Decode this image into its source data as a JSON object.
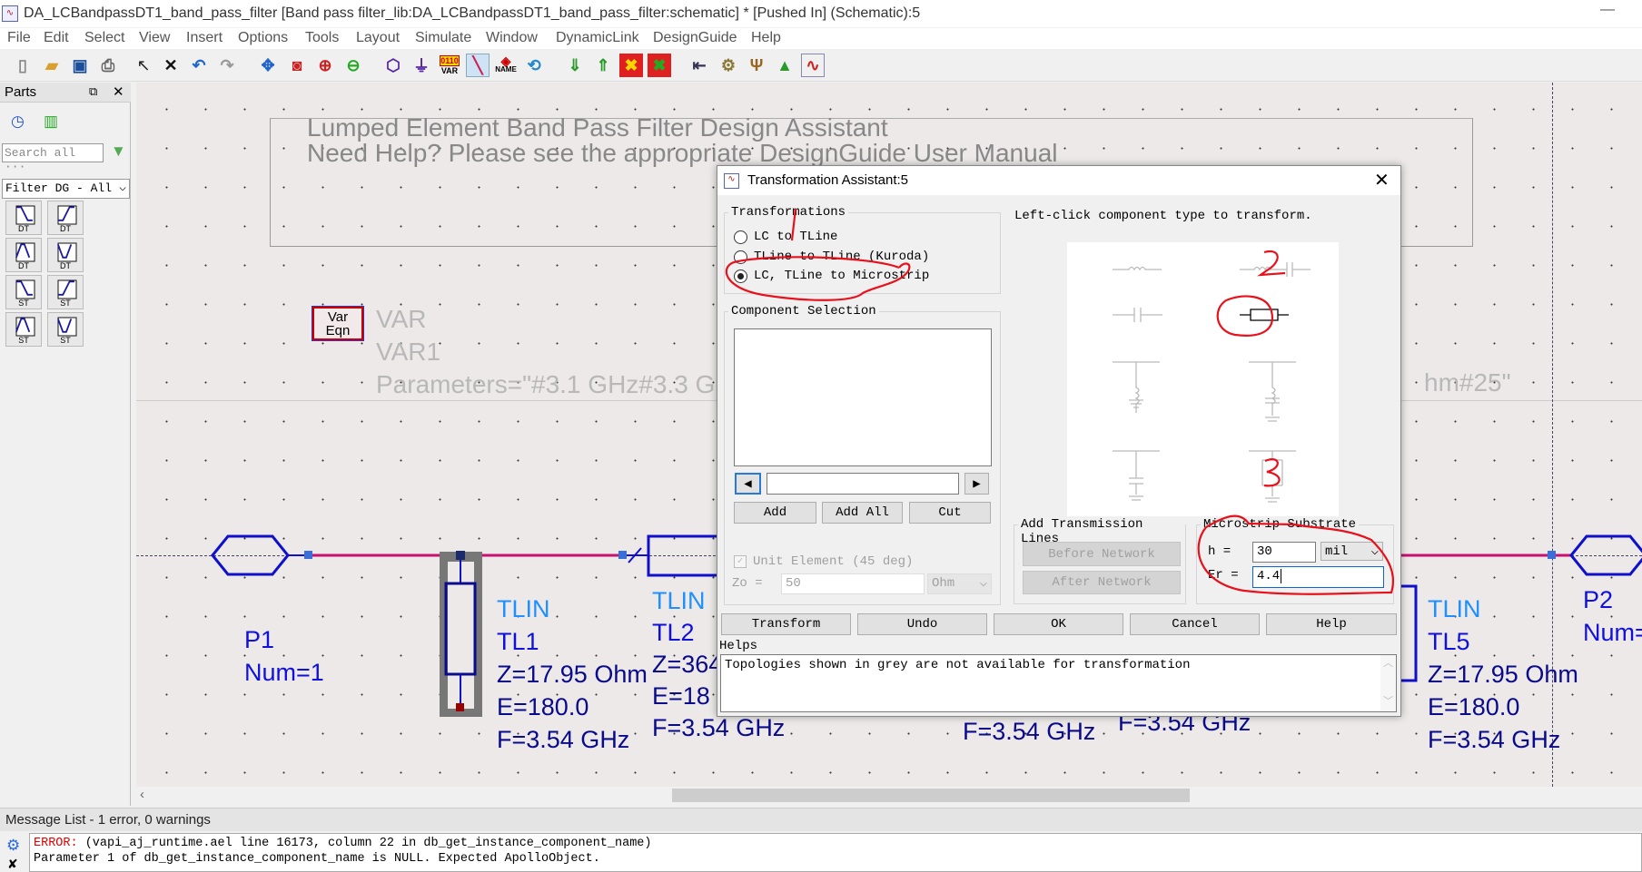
{
  "window": {
    "title": "DA_LCBandpassDT1_band_pass_filter [Band pass filter_lib:DA_LCBandpassDT1_band_pass_filter:schematic] * [Pushed In] (Schematic):5",
    "minimize": "—"
  },
  "menu": [
    "File",
    "Edit",
    "Select",
    "View",
    "Insert",
    "Options",
    "Tools",
    "Layout",
    "Simulate",
    "Window",
    "DynamicLink",
    "DesignGuide",
    "Help"
  ],
  "toolbar": {
    "var_label": "VAR",
    "var_top": "0110",
    "name_label": "NAME"
  },
  "parts": {
    "title": "Parts",
    "search_placeholder": "Search all",
    "search_more": "···",
    "library": "Filter DG - All",
    "items": [
      "DT",
      "DT",
      "DT",
      "DT",
      "ST",
      "ST",
      "ST",
      "ST"
    ]
  },
  "schematic": {
    "banner_line1": "Lumped Element Band Pass Filter Design Assistant",
    "banner_line2": "Need Help?  Please see the appropriate DesignGuide User Manual",
    "var_icon_line1": "Var",
    "var_icon_line2": "Eqn",
    "var_type": "VAR",
    "var_name": "VAR1",
    "var_params_left": "Parameters=\"#3.1 GHz#3.3 G",
    "var_params_right": "hm#25\"",
    "p1": {
      "name": "P1",
      "num": "Num=1"
    },
    "p2": {
      "name": "P2",
      "num": "Num="
    },
    "tl1": {
      "type": "TLIN",
      "name": "TL1",
      "z": "Z=17.95 Ohm",
      "e": "E=180.0",
      "f": "F=3.54 GHz"
    },
    "tl2": {
      "type": "TLIN",
      "name": "TL2",
      "z": "Z=364",
      "e": "E=18",
      "f": "F=3.54 GHz"
    },
    "tl5": {
      "type": "TLIN",
      "name": "TL5",
      "z": "Z=17.95 Ohm",
      "e": "E=180.0",
      "f": "F=3.54 GHz"
    },
    "f_extra1": "F=3.54 GHz",
    "f_extra2": "F=3.54 GHz"
  },
  "dialog": {
    "title": "Transformation Assistant:5",
    "transformations_label": "Transformations",
    "options": [
      {
        "label": "LC to TLine",
        "selected": false
      },
      {
        "label": "TLine to TLine (Kuroda)",
        "selected": false
      },
      {
        "label": "LC, TLine to Microstrip",
        "selected": true
      }
    ],
    "instruction": "Left-click component type to transform.",
    "component_selection_label": "Component Selection",
    "add": "Add",
    "add_all": "Add All",
    "cut": "Cut",
    "unit_element": "Unit Element (45 deg)",
    "unit_element_checked": true,
    "zo_label": "Zo =",
    "zo_value": "50",
    "zo_unit": "Ohm",
    "add_tl_label": "Add Transmission Lines",
    "before_network": "Before Network",
    "after_network": "After Network",
    "substrate_label": "Microstrip Substrate",
    "h_label": "h =",
    "h_value": "30",
    "h_unit": "mil",
    "er_label": "Er =",
    "er_value": "4.4",
    "buttons": [
      "Transform",
      "Undo",
      "OK",
      "Cancel",
      "Help"
    ],
    "helps_label": "Helps",
    "helps_text": "Topologies shown in grey are not available for transformation",
    "annotations": [
      "1",
      "2",
      "3"
    ],
    "annotation_color": "#e8101a"
  },
  "messages": {
    "header": "Message List - 1 error, 0 warnings",
    "error_tag": "ERROR:",
    "line1": " (vapi_aj_runtime.ael line 16173, column 22 in db_get_instance_component_name)",
    "line2": "Parameter 1 of db_get_instance_component_name is NULL. Expected ApolloObject."
  },
  "colors": {
    "wire": "#c8106e",
    "component": "#0a0a8c",
    "label": "#1e90ff",
    "error": "#e00000"
  }
}
